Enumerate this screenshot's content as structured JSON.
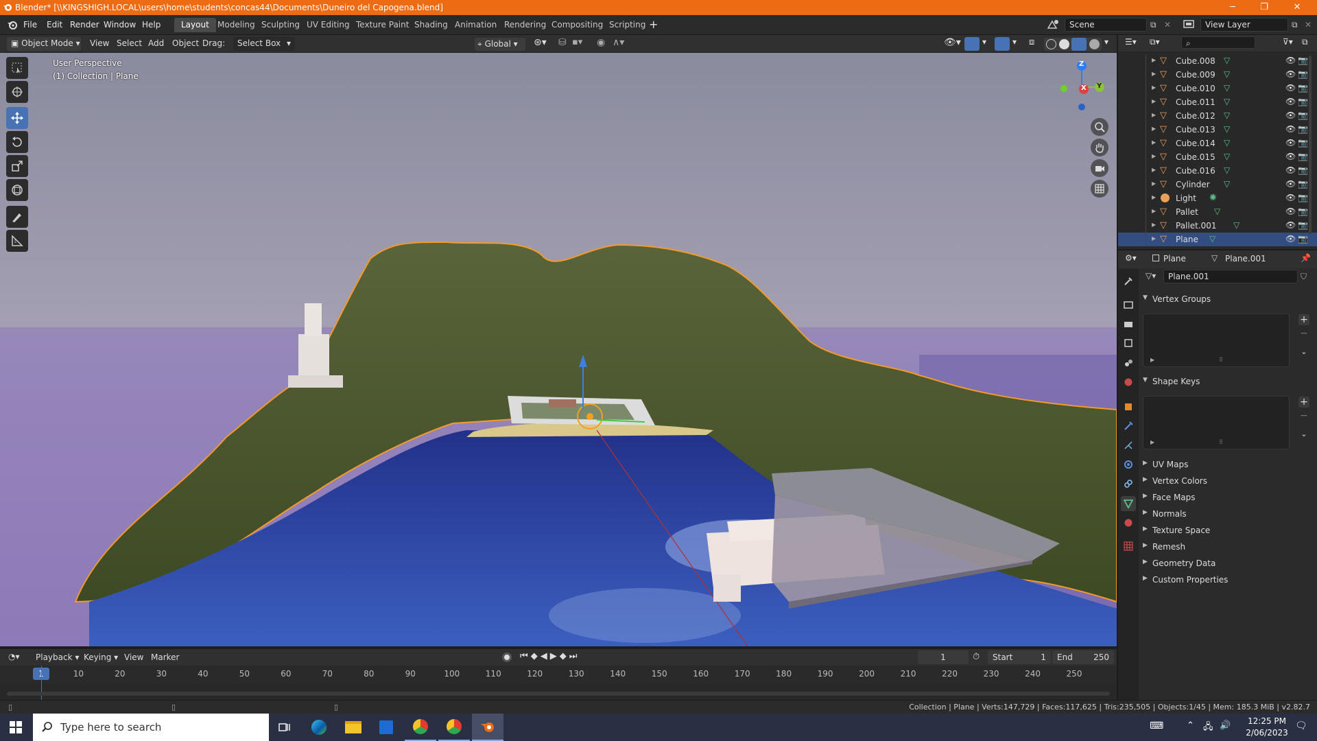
{
  "window": {
    "title": "Blender* [\\\\KINGSHIGH.LOCAL\\users\\home\\students\\concas44\\Documents\\Duneiro del Capogena.blend]",
    "minimize": "─",
    "maximize": "❐",
    "close": "✕"
  },
  "menu": [
    "File",
    "Edit",
    "Render",
    "Window",
    "Help"
  ],
  "workspaces": [
    "Layout",
    "Modeling",
    "Sculpting",
    "UV Editing",
    "Texture Paint",
    "Shading",
    "Animation",
    "Rendering",
    "Compositing",
    "Scripting"
  ],
  "add_workspace": "+",
  "scene": {
    "name": "Scene",
    "view_layer": "View Layer"
  },
  "viewport_header": {
    "mode": "Object Mode",
    "view": "View",
    "select": "Select",
    "add": "Add",
    "object": "Object",
    "drag_label": "Drag:",
    "drag_value": "Select Box",
    "orientation": "Global"
  },
  "viewport": {
    "perspective": "User Perspective",
    "collection": "(1) Collection | Plane",
    "gizmo": {
      "x": "X",
      "y": "Y",
      "z": "Z"
    }
  },
  "outliner": {
    "items": [
      {
        "name": "Cube.008",
        "type": "mesh"
      },
      {
        "name": "Cube.009",
        "type": "mesh"
      },
      {
        "name": "Cube.010",
        "type": "mesh"
      },
      {
        "name": "Cube.011",
        "type": "mesh"
      },
      {
        "name": "Cube.012",
        "type": "mesh"
      },
      {
        "name": "Cube.013",
        "type": "mesh"
      },
      {
        "name": "Cube.014",
        "type": "mesh"
      },
      {
        "name": "Cube.015",
        "type": "mesh"
      },
      {
        "name": "Cube.016",
        "type": "mesh"
      },
      {
        "name": "Cylinder",
        "type": "mesh"
      },
      {
        "name": "Light",
        "type": "light"
      },
      {
        "name": "Pallet",
        "type": "mesh"
      },
      {
        "name": "Pallet.001",
        "type": "mesh"
      },
      {
        "name": "Plane",
        "type": "mesh",
        "selected": true
      }
    ]
  },
  "properties": {
    "object": "Plane",
    "mesh": "Plane.001",
    "data_name": "Plane.001",
    "panels": {
      "vertex_groups": "Vertex Groups",
      "shape_keys": "Shape Keys",
      "uv_maps": "UV Maps",
      "vertex_colors": "Vertex Colors",
      "face_maps": "Face Maps",
      "normals": "Normals",
      "texture_space": "Texture Space",
      "remesh": "Remesh",
      "geometry_data": "Geometry Data",
      "custom_properties": "Custom Properties"
    }
  },
  "timeline": {
    "playback": "Playback",
    "keying": "Keying",
    "view": "View",
    "marker": "Marker",
    "current_frame": "1",
    "start_label": "Start",
    "start": "1",
    "end_label": "End",
    "end": "250",
    "ticks": [
      "1",
      "10",
      "20",
      "30",
      "40",
      "50",
      "60",
      "70",
      "80",
      "90",
      "100",
      "110",
      "120",
      "130",
      "140",
      "150",
      "160",
      "170",
      "180",
      "190",
      "200",
      "210",
      "220",
      "230",
      "240",
      "250"
    ]
  },
  "status": "Collection | Plane | Verts:147,729 | Faces:117,625 | Tris:235,505 | Objects:1/45 | Mem: 185.3 MiB | v2.82.7",
  "taskbar": {
    "search_placeholder": "Type here to search",
    "time": "12:25 PM",
    "date": "2/06/2023"
  },
  "colors": {
    "title_bar": "#ec6b13",
    "selection": "#4772b3",
    "terrain": "#4d5a2a",
    "water": "#2a3f9a",
    "mesh_icon": "#e9a15a",
    "data_icon": "#5fbf8f"
  }
}
